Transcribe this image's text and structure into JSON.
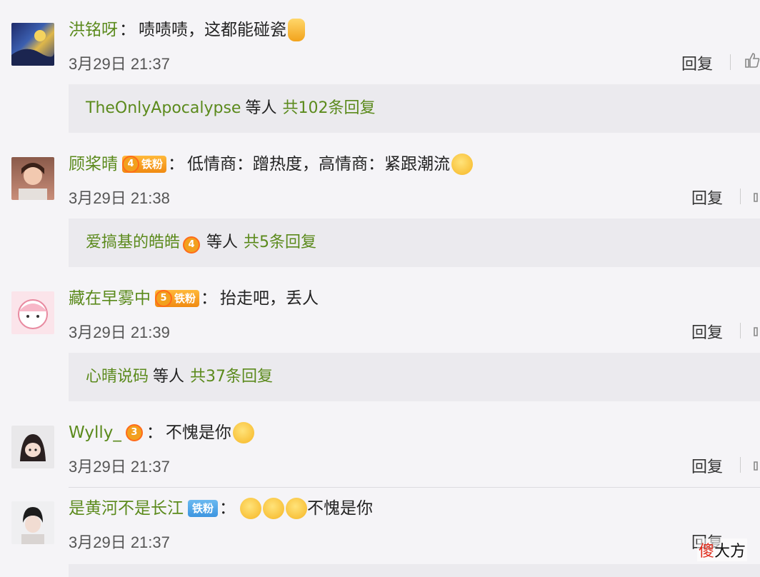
{
  "comments": [
    {
      "username": "洪铭呀",
      "badge": null,
      "text": "啧啧啧，这都能碰瓷",
      "emojis": [
        "thumbs-up"
      ],
      "time": "3月29日 21:37",
      "reply_label": "回复",
      "thread": {
        "name": "TheOnlyApocalypse",
        "etc": "等人",
        "count": "共102条回复"
      }
    },
    {
      "username": "顾桨晴",
      "badge": {
        "level": "4",
        "label": "铁粉"
      },
      "text": "低情商：蹭热度，高情商：紧跟潮流",
      "emojis": [
        "smirk-face"
      ],
      "time": "3月29日 21:38",
      "reply_label": "回复",
      "thread": {
        "name": "爱搞基的皓皓",
        "badge_level": "4",
        "etc": "等人",
        "count": "共5条回复"
      }
    },
    {
      "username": "藏在早雾中",
      "badge": {
        "level": "5",
        "label": "铁粉"
      },
      "text": "抬走吧，丢人",
      "emojis": [],
      "time": "3月29日 21:39",
      "reply_label": "回复",
      "thread": {
        "name": "心晴说码",
        "etc": "等人",
        "count": "共37条回复"
      }
    },
    {
      "username": "Wylly_",
      "badge": {
        "level": "3"
      },
      "text": "不愧是你",
      "emojis": [
        "doge-face"
      ],
      "time": "3月29日 21:37",
      "reply_label": "回复"
    },
    {
      "username": "是黄河不是长江",
      "badge": {
        "label": "铁粉",
        "color": "blue"
      },
      "text": "不愧是你",
      "emojis": [
        "doge-face",
        "doge-face",
        "doge-face"
      ],
      "time": "3月29日 21:37",
      "reply_label": "回复"
    }
  ],
  "watermark": {
    "red": "傻",
    "rest": "大方"
  },
  "colors": {
    "username": "#5b8a1c",
    "background": "#f5f4f7",
    "reply_box": "#ebeaee"
  }
}
